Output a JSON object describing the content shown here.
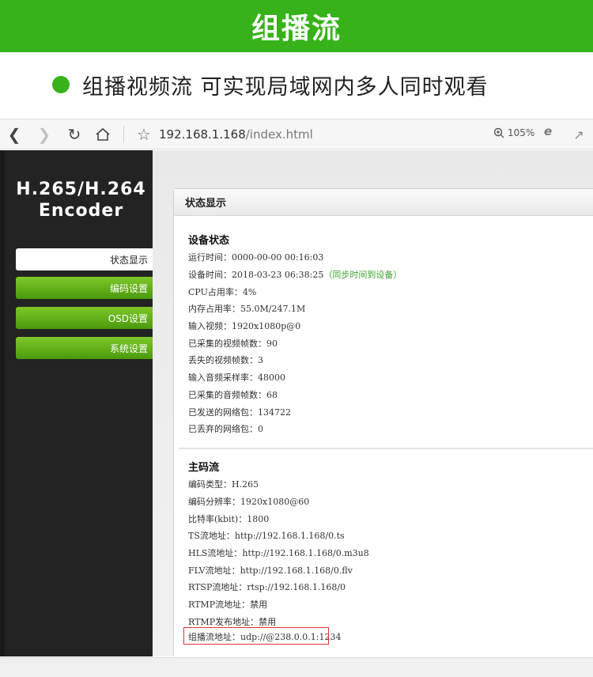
{
  "banner": {
    "title": "组播流",
    "color": "#37b21a"
  },
  "headline": {
    "text": "组播视频流 可实现局域网内多人同时观看"
  },
  "browser": {
    "url_host": "192.168.1.168",
    "url_path": "/index.html",
    "zoom": "105%",
    "icons": [
      "back-icon",
      "forward-icon",
      "reload-icon",
      "home-icon",
      "star-icon",
      "zoom-icon",
      "ie-icon",
      "share-icon"
    ]
  },
  "sidebar": {
    "logo_line1": "H.265/H.264",
    "logo_line2": "Encoder",
    "items": [
      {
        "label": "状态显示",
        "active": true
      },
      {
        "label": "编码设置",
        "active": false
      },
      {
        "label": "OSD设置",
        "active": false
      },
      {
        "label": "系统设置",
        "active": false
      }
    ]
  },
  "panel": {
    "title": "状态显示",
    "device_status": {
      "title": "设备状态",
      "rows": [
        "运行时间：0000-00-00 00:16:03",
        "设备时间：2018-03-23 06:38:25",
        "CPU占用率：4%",
        "内存占用率：55.0M/247.1M",
        "输入视频：1920x1080p@0",
        "已采集的视频帧数：90",
        "丢失的视频帧数：3",
        "输入音频采样率：48000",
        "已采集的音频帧数：68",
        "已发送的网络包：134722",
        "已丢弃的网络包：0"
      ],
      "sync_hint": "（同步时间到设备）"
    },
    "main_stream": {
      "title": "主码流",
      "rows": [
        "编码类型：H.265",
        "编码分辨率：1920x1080@60",
        "比特率(kbit)：1800",
        "TS流地址：http://192.168.1.168/0.ts",
        "HLS流地址：http://192.168.1.168/0.m3u8",
        "FLV流地址：http://192.168.1.168/0.flv",
        "RTSP流地址：rtsp://192.168.1.168/0",
        "RTMP流地址：禁用",
        "RTMP发布地址：禁用",
        "组播流地址：udp://@238.0.0.1:1234"
      ]
    }
  }
}
